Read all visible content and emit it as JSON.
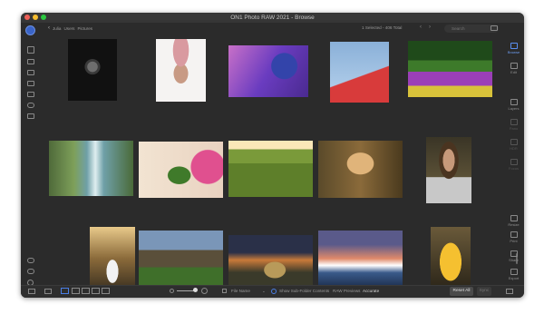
{
  "window": {
    "title": "ON1 Photo RAW 2021 - Browse"
  },
  "breadcrumb": {
    "back_glyph": "‹",
    "path": [
      "Julia",
      "Users",
      "Pictures"
    ]
  },
  "selection": {
    "text": "1 Selected - 406 Total"
  },
  "search": {
    "placeholder": "Search"
  },
  "right_panel": {
    "items": [
      {
        "label": "Browse",
        "state": "active"
      },
      {
        "label": "Edit",
        "state": "normal"
      },
      {
        "label": "Layers",
        "state": "normal"
      },
      {
        "label": "Pano",
        "state": "dim"
      },
      {
        "label": "HDR",
        "state": "dim"
      },
      {
        "label": "Focus",
        "state": "dim"
      },
      {
        "label": "Resize",
        "state": "normal"
      },
      {
        "label": "Print",
        "state": "normal"
      },
      {
        "label": "Share",
        "state": "normal"
      },
      {
        "label": "Export",
        "state": "normal"
      }
    ]
  },
  "statusbar": {
    "sort_label": "File Name",
    "subfolder_label": "Show Sub-Folder Contents",
    "raw_previews_label": "RAW Previews",
    "raw_previews_value": "Accurate",
    "reset_all": "Reset All",
    "sync": "Sync"
  },
  "thumbnails": [
    {
      "name": "woman-bw-headdress"
    },
    {
      "name": "woman-flower-crown"
    },
    {
      "name": "blue-purple-flowers"
    },
    {
      "name": "red-building-blue-sky"
    },
    {
      "name": "tulip-field"
    },
    {
      "name": "river-waterfall"
    },
    {
      "name": "pink-rose-leaf"
    },
    {
      "name": "vineyard-rows"
    },
    {
      "name": "blonde-woman-sunset"
    },
    {
      "name": "woman-striped-shirt"
    },
    {
      "name": "woman-white-dress-forest"
    },
    {
      "name": "house-evening-lights"
    },
    {
      "name": "hay-bale-sunset"
    },
    {
      "name": "snow-mountains-sunset"
    },
    {
      "name": "yellow-classic-car"
    }
  ],
  "colors": {
    "accent": "#4a7fe6",
    "window_bg": "#2b2b2b"
  }
}
